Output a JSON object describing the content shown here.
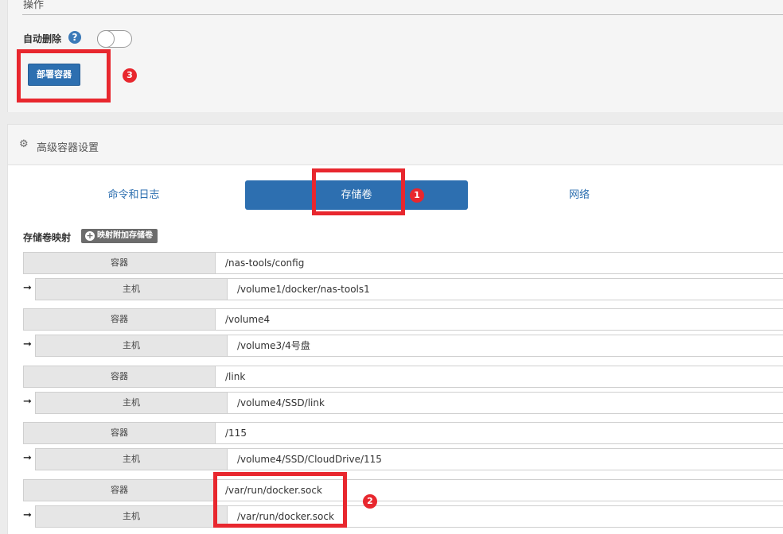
{
  "operation": {
    "section_label": "操作",
    "auto_remove_label": "自动删除",
    "help_symbol": "?",
    "deploy_button": "部署容器"
  },
  "badges": {
    "b1": "1",
    "b2": "2",
    "b3": "3"
  },
  "advanced": {
    "title": "高级容器设置",
    "tabs": [
      {
        "label": "命令和日志"
      },
      {
        "label": "存储卷"
      },
      {
        "label": "网络"
      }
    ],
    "volume_label": "存储卷映射",
    "add_volume_button": "映射附加存储卷",
    "mappings": [
      {
        "container_label": "容器",
        "container_path": "/nas-tools/config",
        "host_label": "主机",
        "host_path": "/volume1/docker/nas-tools1"
      },
      {
        "container_label": "容器",
        "container_path": "/volume4",
        "host_label": "主机",
        "host_path": "/volume3/4号盘"
      },
      {
        "container_label": "容器",
        "container_path": "/link",
        "host_label": "主机",
        "host_path": "/volume4/SSD/link"
      },
      {
        "container_label": "容器",
        "container_path": "/115",
        "host_label": "主机",
        "host_path": "/volume4/SSD/CloudDrive/115"
      },
      {
        "container_label": "容器",
        "container_path": "/var/run/docker.sock",
        "host_label": "主机",
        "host_path": "/var/run/docker.sock"
      }
    ]
  },
  "colors": {
    "accent": "#2d6fb0",
    "annotation": "#e8272e"
  }
}
